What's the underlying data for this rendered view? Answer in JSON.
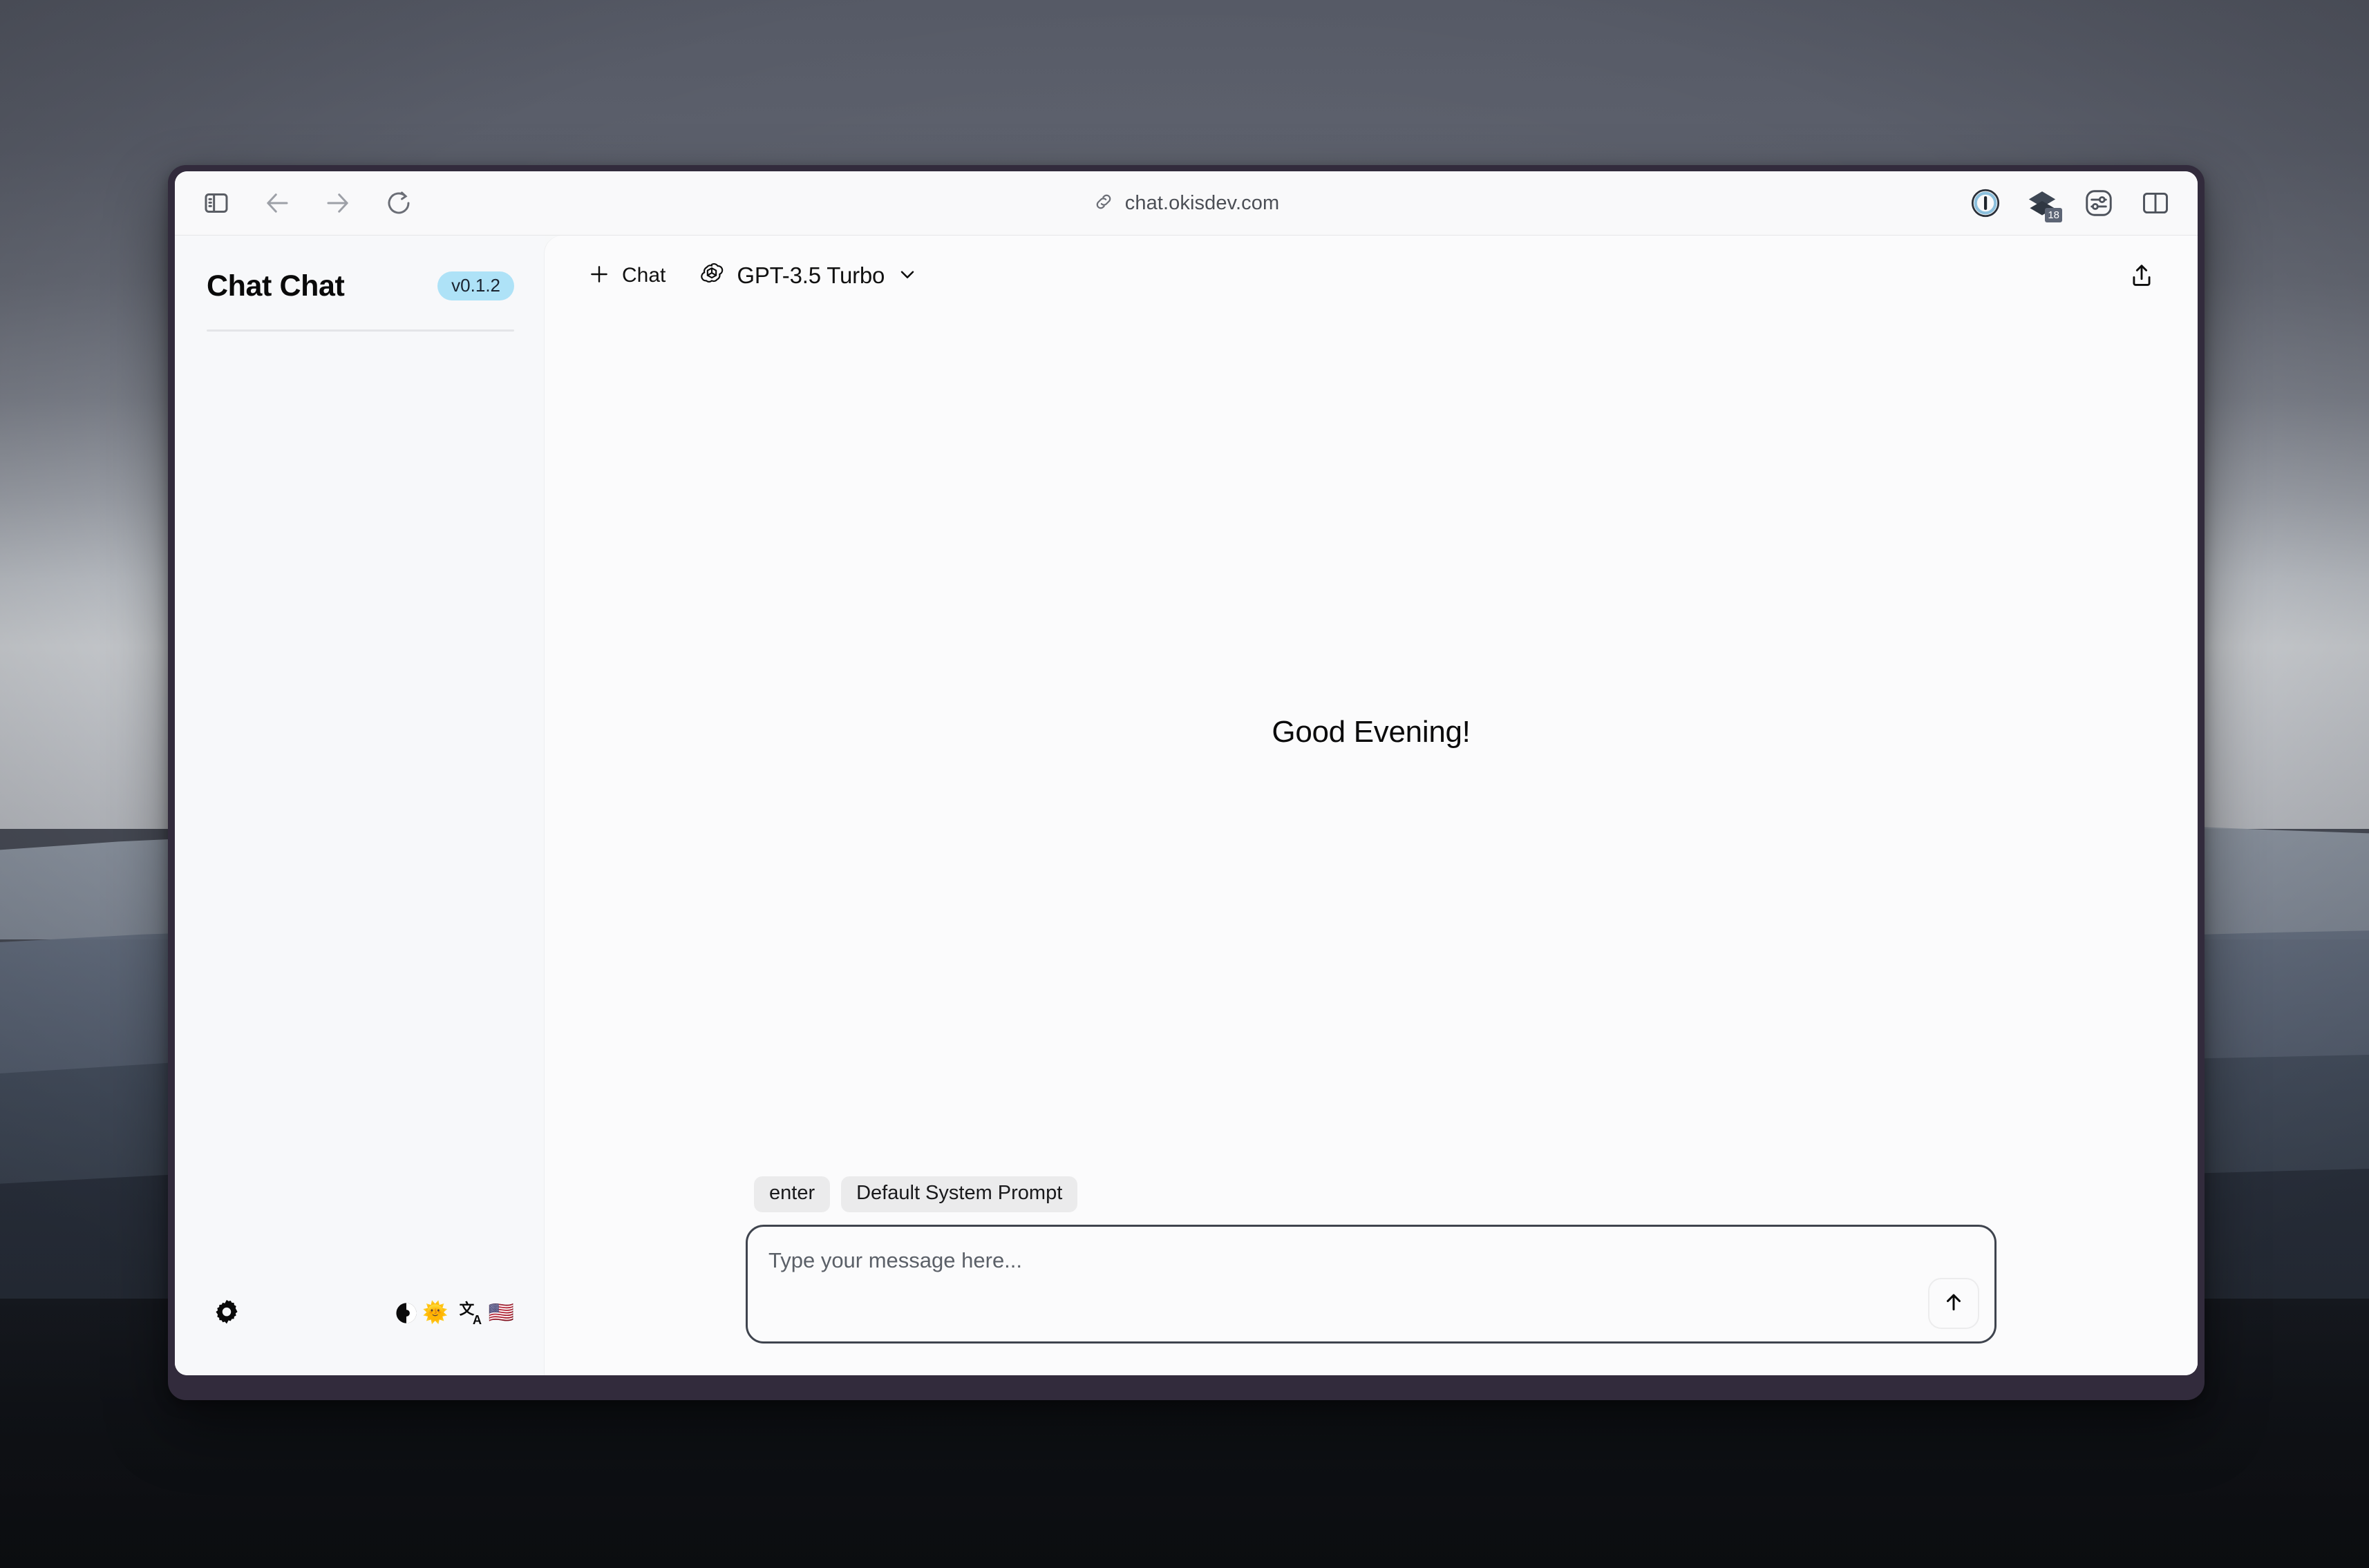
{
  "browser": {
    "url": "chat.okisdev.com",
    "toolbar_buttons": [
      {
        "name": "sidebar-toggle",
        "icon": "sidebar-icon"
      },
      {
        "name": "back",
        "icon": "arrow-left-icon"
      },
      {
        "name": "forward",
        "icon": "arrow-right-icon"
      },
      {
        "name": "reload",
        "icon": "reload-icon"
      }
    ],
    "extensions": [
      {
        "name": "1password",
        "icon": "onepassword-icon",
        "badge": ""
      },
      {
        "name": "layers-extension",
        "icon": "layers-icon",
        "badge": "18"
      },
      {
        "name": "sliders-extension",
        "icon": "sliders-icon",
        "badge": ""
      },
      {
        "name": "split-view",
        "icon": "split-panel-icon",
        "badge": ""
      }
    ]
  },
  "sidebar": {
    "app_title": "Chat Chat",
    "version": "v0.1.2",
    "conversations": [],
    "footer": {
      "settings_icon": "gear-icon",
      "theme_icon": "contrast-circle-icon",
      "theme_emoji": "🌞",
      "translate_icon": "translate-icon",
      "language_emoji": "🇺🇸"
    }
  },
  "chat": {
    "new_chat_label": "Chat",
    "new_chat_icon": "plus-icon",
    "model_icon": "openai-logo-icon",
    "model_name": "GPT-3.5 Turbo",
    "model_chevron": "chevron-down-icon",
    "share_icon": "share-icon",
    "greeting": "Good Evening!"
  },
  "composer": {
    "chips": [
      "enter",
      "Default System Prompt"
    ],
    "placeholder": "Type your message here...",
    "value": "",
    "send_icon": "arrow-up-icon"
  },
  "colors": {
    "accent_badge": "#aee2f7",
    "input_border": "#3f444e",
    "chip_bg": "#ebebec",
    "window_frame": "#322b3c"
  }
}
